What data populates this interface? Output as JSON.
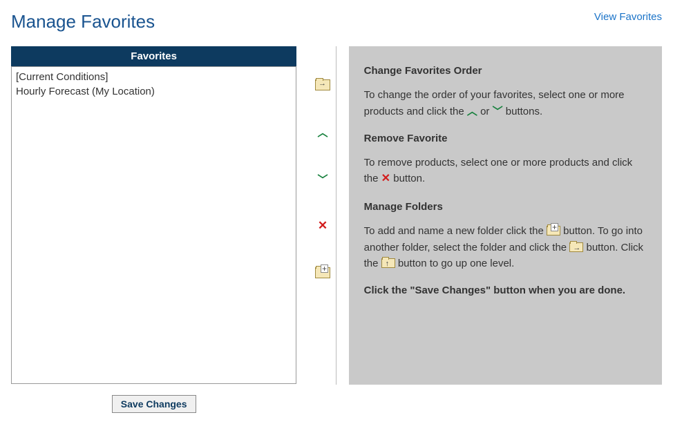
{
  "header": {
    "title": "Manage Favorites",
    "view_link": "View Favorites"
  },
  "favorites": {
    "panel_title": "Favorites",
    "items": [
      "[Current Conditions]",
      "Hourly Forecast (My Location)"
    ]
  },
  "save_button_label": "Save Changes",
  "help": {
    "order_title": "Change Favorites Order",
    "order_text_a": "To change the order of your favorites, select one or more products and click the ",
    "order_text_b": " or ",
    "order_text_c": " buttons.",
    "remove_title": "Remove Favorite",
    "remove_text_a": "To remove products, select one or more products and click the ",
    "remove_text_b": " button.",
    "folders_title": "Manage Folders",
    "folders_text_a": "To add and name a new folder click the ",
    "folders_text_b": " button. To go into another folder, select the folder and click the ",
    "folders_text_c": " button. Click the ",
    "folders_text_d": " button to go up one level.",
    "save_note": "Click the \"Save Changes\" button when you are done."
  }
}
